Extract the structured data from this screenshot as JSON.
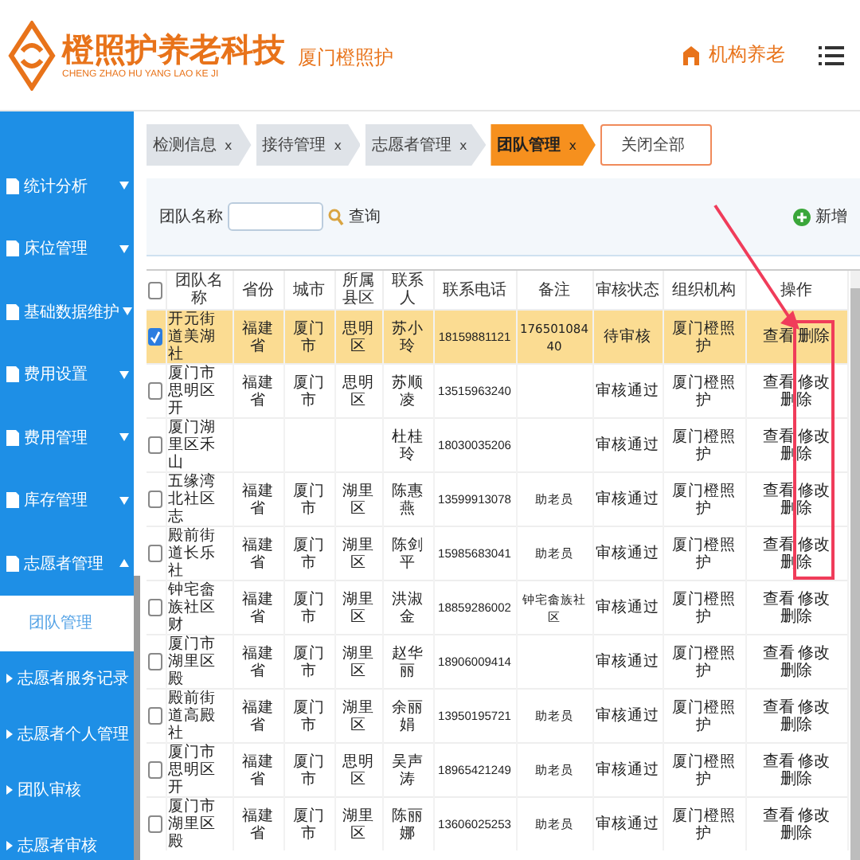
{
  "header": {
    "brand": "橙照护养老科技",
    "brand_subtitle": "CHENG ZHAO HU YANG LAO KE JI",
    "site": "厦门橙照护",
    "module": "机构养老"
  },
  "sidebar": {
    "items": [
      {
        "label": "统计分析",
        "expanded": false
      },
      {
        "label": "床位管理",
        "expanded": false
      },
      {
        "label": "基础数据维护",
        "expanded": false
      },
      {
        "label": "费用设置",
        "expanded": false
      },
      {
        "label": "费用管理",
        "expanded": false
      },
      {
        "label": "库存管理",
        "expanded": false
      },
      {
        "label": "志愿者管理",
        "expanded": true,
        "children": [
          {
            "label": "团队管理",
            "selected": true
          },
          {
            "label": "志愿者服务记录",
            "selected": false
          },
          {
            "label": "志愿者个人管理",
            "selected": false
          },
          {
            "label": "团队审核",
            "selected": false
          },
          {
            "label": "志愿者审核",
            "selected": false
          }
        ]
      }
    ]
  },
  "tabs": [
    {
      "kind": "page",
      "label": "检测信息",
      "close": "x",
      "selected": false
    },
    {
      "kind": "page",
      "label": "接待管理",
      "close": "x",
      "selected": false
    },
    {
      "kind": "page",
      "label": "志愿者管理",
      "close": "x",
      "selected": false
    },
    {
      "kind": "page",
      "label": "团队管理",
      "close": "x",
      "selected": true
    },
    {
      "kind": "close_all",
      "label": "关闭全部",
      "selected": false
    }
  ],
  "search": {
    "label": "团队名称",
    "button": "查询",
    "add_button": "新增"
  },
  "table": {
    "header_checked": false,
    "columns": [
      "团队名称",
      "省份",
      "城市",
      "所属县区",
      "联系人",
      "联系电话",
      "备注",
      "审核状态",
      "组织机构",
      "操作"
    ],
    "rows": [
      {
        "checked": true,
        "selected": true,
        "annotated": true,
        "cells": [
          "开元街道美湖社",
          "福建省",
          "厦门市",
          "思明区",
          "苏小玲",
          "18159881121",
          "17650108440",
          "待审核",
          "厦门橙照护"
        ],
        "actions": [
          "查看",
          "删除"
        ]
      },
      {
        "checked": false,
        "selected": false,
        "annotated": true,
        "cells": [
          "厦门市思明区开",
          "福建省",
          "厦门市",
          "思明区",
          "苏顺凌",
          "13515963240",
          "",
          "审核通过",
          "厦门橙照护"
        ],
        "actions": [
          "查看",
          "修改",
          "删除"
        ]
      },
      {
        "checked": false,
        "selected": false,
        "annotated": true,
        "cells": [
          "厦门湖里区禾山",
          "",
          "",
          "",
          "杜桂玲",
          "18030035206",
          "",
          "审核通过",
          "厦门橙照护"
        ],
        "actions": [
          "查看",
          "修改",
          "删除"
        ]
      },
      {
        "checked": false,
        "selected": false,
        "annotated": true,
        "cells": [
          "五缘湾北社区志",
          "福建省",
          "厦门市",
          "湖里区",
          "陈惠燕",
          "13599913078",
          "助老员",
          "审核通过",
          "厦门橙照护"
        ],
        "actions": [
          "查看",
          "修改",
          "删除"
        ]
      },
      {
        "checked": false,
        "selected": false,
        "annotated": true,
        "cells": [
          "殿前街道长乐社",
          "福建省",
          "厦门市",
          "湖里区",
          "陈剑平",
          "15985683041",
          "助老员",
          "审核通过",
          "厦门橙照护"
        ],
        "actions": [
          "查看",
          "修改",
          "删除"
        ]
      },
      {
        "checked": false,
        "selected": false,
        "annotated": false,
        "cells": [
          "钟宅畲族社区财",
          "福建省",
          "厦门市",
          "湖里区",
          "洪淑金",
          "18859286002",
          "钟宅畲族社区",
          "审核通过",
          "厦门橙照护"
        ],
        "actions": [
          "查看",
          "修改",
          "删除"
        ]
      },
      {
        "checked": false,
        "selected": false,
        "annotated": false,
        "cells": [
          "厦门市湖里区殿",
          "福建省",
          "厦门市",
          "湖里区",
          "赵华丽",
          "18906009414",
          "",
          "审核通过",
          "厦门橙照护"
        ],
        "actions": [
          "查看",
          "修改",
          "删除"
        ]
      },
      {
        "checked": false,
        "selected": false,
        "annotated": false,
        "cells": [
          "殿前街道高殿社",
          "福建省",
          "厦门市",
          "湖里区",
          "余丽娟",
          "13950195721",
          "助老员",
          "审核通过",
          "厦门橙照护"
        ],
        "actions": [
          "查看",
          "修改",
          "删除"
        ]
      },
      {
        "checked": false,
        "selected": false,
        "annotated": false,
        "cells": [
          "厦门市思明区开",
          "福建省",
          "厦门市",
          "思明区",
          "吴声涛",
          "18965421249",
          "助老员",
          "审核通过",
          "厦门橙照护"
        ],
        "actions": [
          "查看",
          "修改",
          "删除"
        ]
      },
      {
        "checked": false,
        "selected": false,
        "annotated": false,
        "cells": [
          "厦门市湖里区殿",
          "福建省",
          "厦门市",
          "湖里区",
          "陈丽娜",
          "13606025253",
          "助老员",
          "审核通过",
          "厦门橙照护"
        ],
        "actions": [
          "查看",
          "修改",
          "删除"
        ]
      }
    ]
  }
}
